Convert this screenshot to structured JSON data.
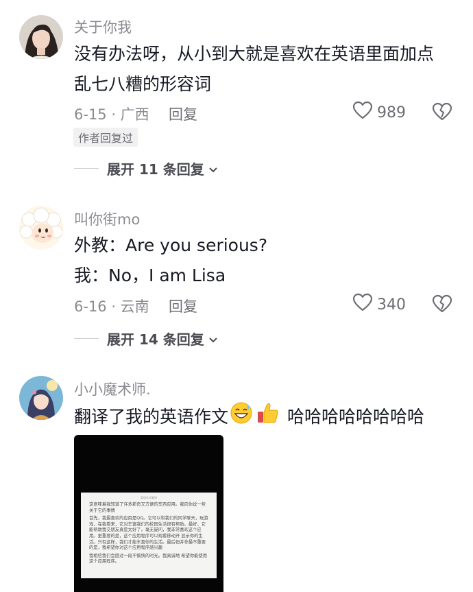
{
  "comments": [
    {
      "username": "关于你我",
      "lines": [
        "没有办法呀，从小到大就是喜欢在英语里面加点",
        "乱七八糟的形容词"
      ],
      "date_location": "6-15 · 广西",
      "reply_label": "回复",
      "likes": "989",
      "badge": "作者回复过",
      "expand_label": "展开 11 条回复"
    },
    {
      "username": "叫你街mo",
      "lines": [
        "外教：Are you serious?",
        "我：No，I am Lisa"
      ],
      "date_location": "6-16 · 云南",
      "reply_label": "回复",
      "likes": "340",
      "expand_label": "展开 14 条回复"
    },
    {
      "username": "小小魔术师.",
      "text_before_emoji": "翻译了我的英语作文",
      "text_after_emoji": "哈哈哈哈哈哈哈哈",
      "emojis": [
        "grinning-sweat-emoji",
        "thumbs-up-emoji"
      ],
      "image": {
        "title": "英语作文翻译",
        "paragraphs": [
          "这意味着我知道了许多新奇又方便的东西应用。我向你说一些关于它的事情",
          "首先，我最喜欢的应用是QQ。它可以和我们的同学聊天，玩游戏，在我看来，它对丰富我们的校园生活很有帮助。最好，它能帮助我交朋友真是太好了。毫无疑问，我非常喜欢这个应用。更重要的是，这个应用程序可以观看移动开 显示你的生活。只有这样，我们才能丰富你的生活。最后但并非最不重要的是，我希望你对这个应用程序感兴趣",
          "我相信我们会度过一段不愉快的时光。我真诚地 希望你能使用这个应用程序。"
        ]
      }
    }
  ],
  "colors": {
    "primary_text": "#161823",
    "secondary_text": "#8a8b91",
    "badge_bg": "#f1f1f2"
  },
  "icons": [
    "heart-outline-icon",
    "broken-heart-icon",
    "chevron-down-icon"
  ]
}
